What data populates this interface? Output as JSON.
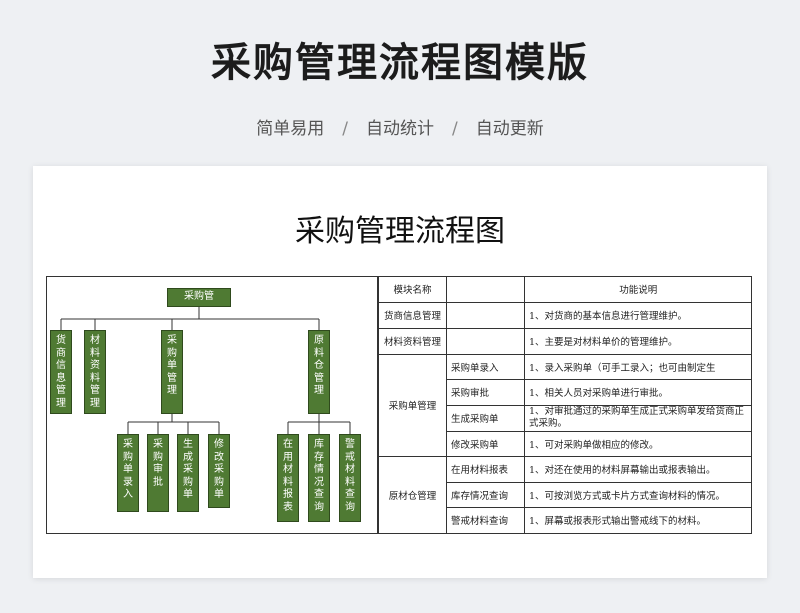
{
  "header": {
    "title": "采购管理流程图模版",
    "tags": [
      "简单易用",
      "自动统计",
      "自动更新"
    ],
    "separator": "/"
  },
  "document": {
    "title": "采购管理流程图"
  },
  "org_chart": {
    "root": "采购管",
    "level1": [
      "货商信息管理",
      "材料资料管理",
      "采购单管理",
      "原料仓管理"
    ],
    "purchase_children": [
      "采购单录入",
      "采购审批",
      "生成采购单",
      "修改采购单"
    ],
    "warehouse_children": [
      "在用材料报表",
      "库存情况查询",
      "警戒材料查询"
    ],
    "colors": {
      "box_fill": "#4f7a33",
      "box_text": "#ffffff"
    }
  },
  "table": {
    "headers": {
      "module": "模块名称",
      "function": "功能说明"
    },
    "rows": [
      {
        "module": "货商信息管理",
        "sub": "",
        "desc": "1、对货商的基本信息进行管理维护。"
      },
      {
        "module": "材料资料管理",
        "sub": "",
        "desc": "1、主要是对材料单价的管理维护。"
      },
      {
        "module": "采购单管理",
        "sub": "采购单录入",
        "desc": "1、录入采购单（可手工录入；也可由制定生"
      },
      {
        "sub": "采购审批",
        "desc": "1、相关人员对采购单进行审批。"
      },
      {
        "sub": "生成采购单",
        "desc": "1、对审批通过的采购单生成正式采购单发给货商正式采购。"
      },
      {
        "sub": "修改采购单",
        "desc": "1、可对采购单做相应的修改。"
      },
      {
        "module": "原材仓管理",
        "sub": "在用材料报表",
        "desc": "1、对还在使用的材料屏幕输出或报表输出。"
      },
      {
        "sub": "库存情况查询",
        "desc": "1、可按浏览方式或卡片方式查询材料的情况。"
      },
      {
        "sub": "警戒材料查询",
        "desc": "1、屏幕或报表形式输出警戒线下的材料。"
      }
    ]
  }
}
